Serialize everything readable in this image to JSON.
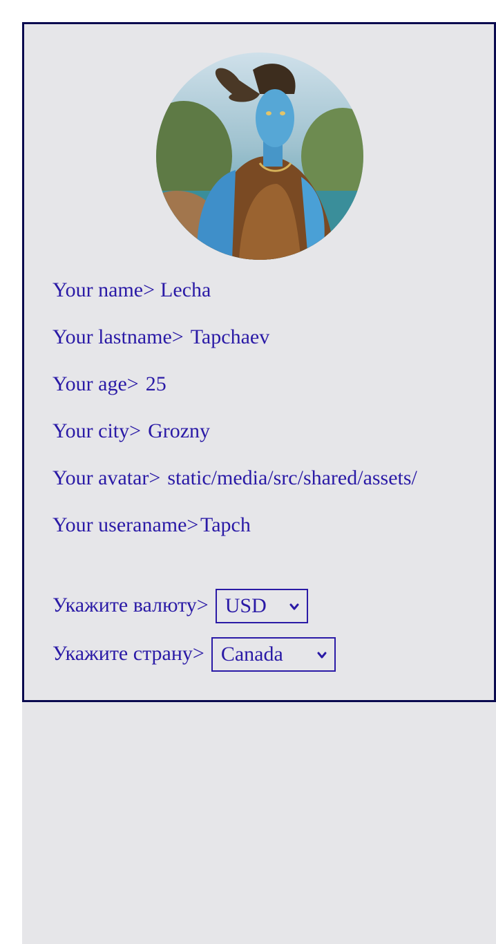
{
  "avatar": {
    "alt": ""
  },
  "profile": {
    "name": {
      "label": "Your name>",
      "value": "Lecha"
    },
    "lastname": {
      "label": "Your lastname>",
      "value": "Tapchaev"
    },
    "age": {
      "label": "Your age>",
      "value": "25"
    },
    "city": {
      "label": "Your city>",
      "value": "Grozny"
    },
    "avatar_path": {
      "label": "Your avatar>",
      "value": "static/media/src/shared/assets/"
    },
    "username": {
      "label": "Your useraname>",
      "value": "Tapch"
    }
  },
  "currency": {
    "label": "Укажите валюту>",
    "selected": "USD"
  },
  "country": {
    "label": "Укажите страну>",
    "selected": "Canada"
  },
  "colors": {
    "text": "#2a1aa6",
    "border": "#0a0a4f",
    "panel": "#e6e6e9"
  }
}
